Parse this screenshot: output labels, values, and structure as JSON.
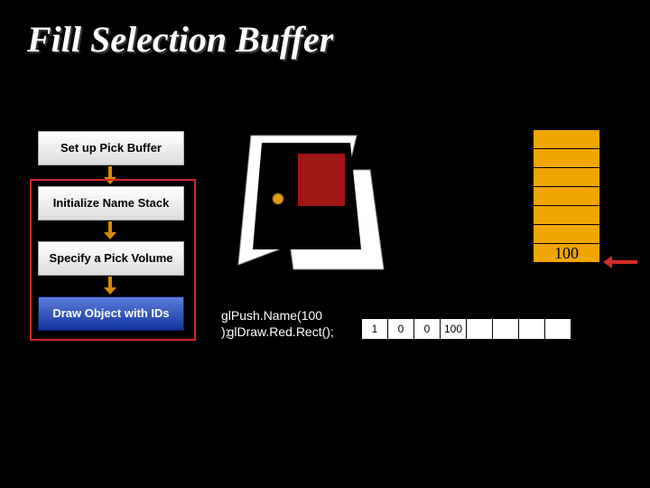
{
  "title": "Fill Selection Buffer",
  "steps": {
    "s1": "Set up Pick Buffer",
    "s2": "Initialize Name Stack",
    "s3": "Specify a Pick Volume",
    "s4": "Draw Object with IDs"
  },
  "stack": {
    "filled": "100"
  },
  "code": {
    "l1": "glPush.Name(100",
    "l2": ");",
    "l3": "glDraw.Red.Rect();"
  },
  "buffer": [
    "1",
    "0",
    "0",
    "100",
    "",
    "",
    "",
    ""
  ]
}
